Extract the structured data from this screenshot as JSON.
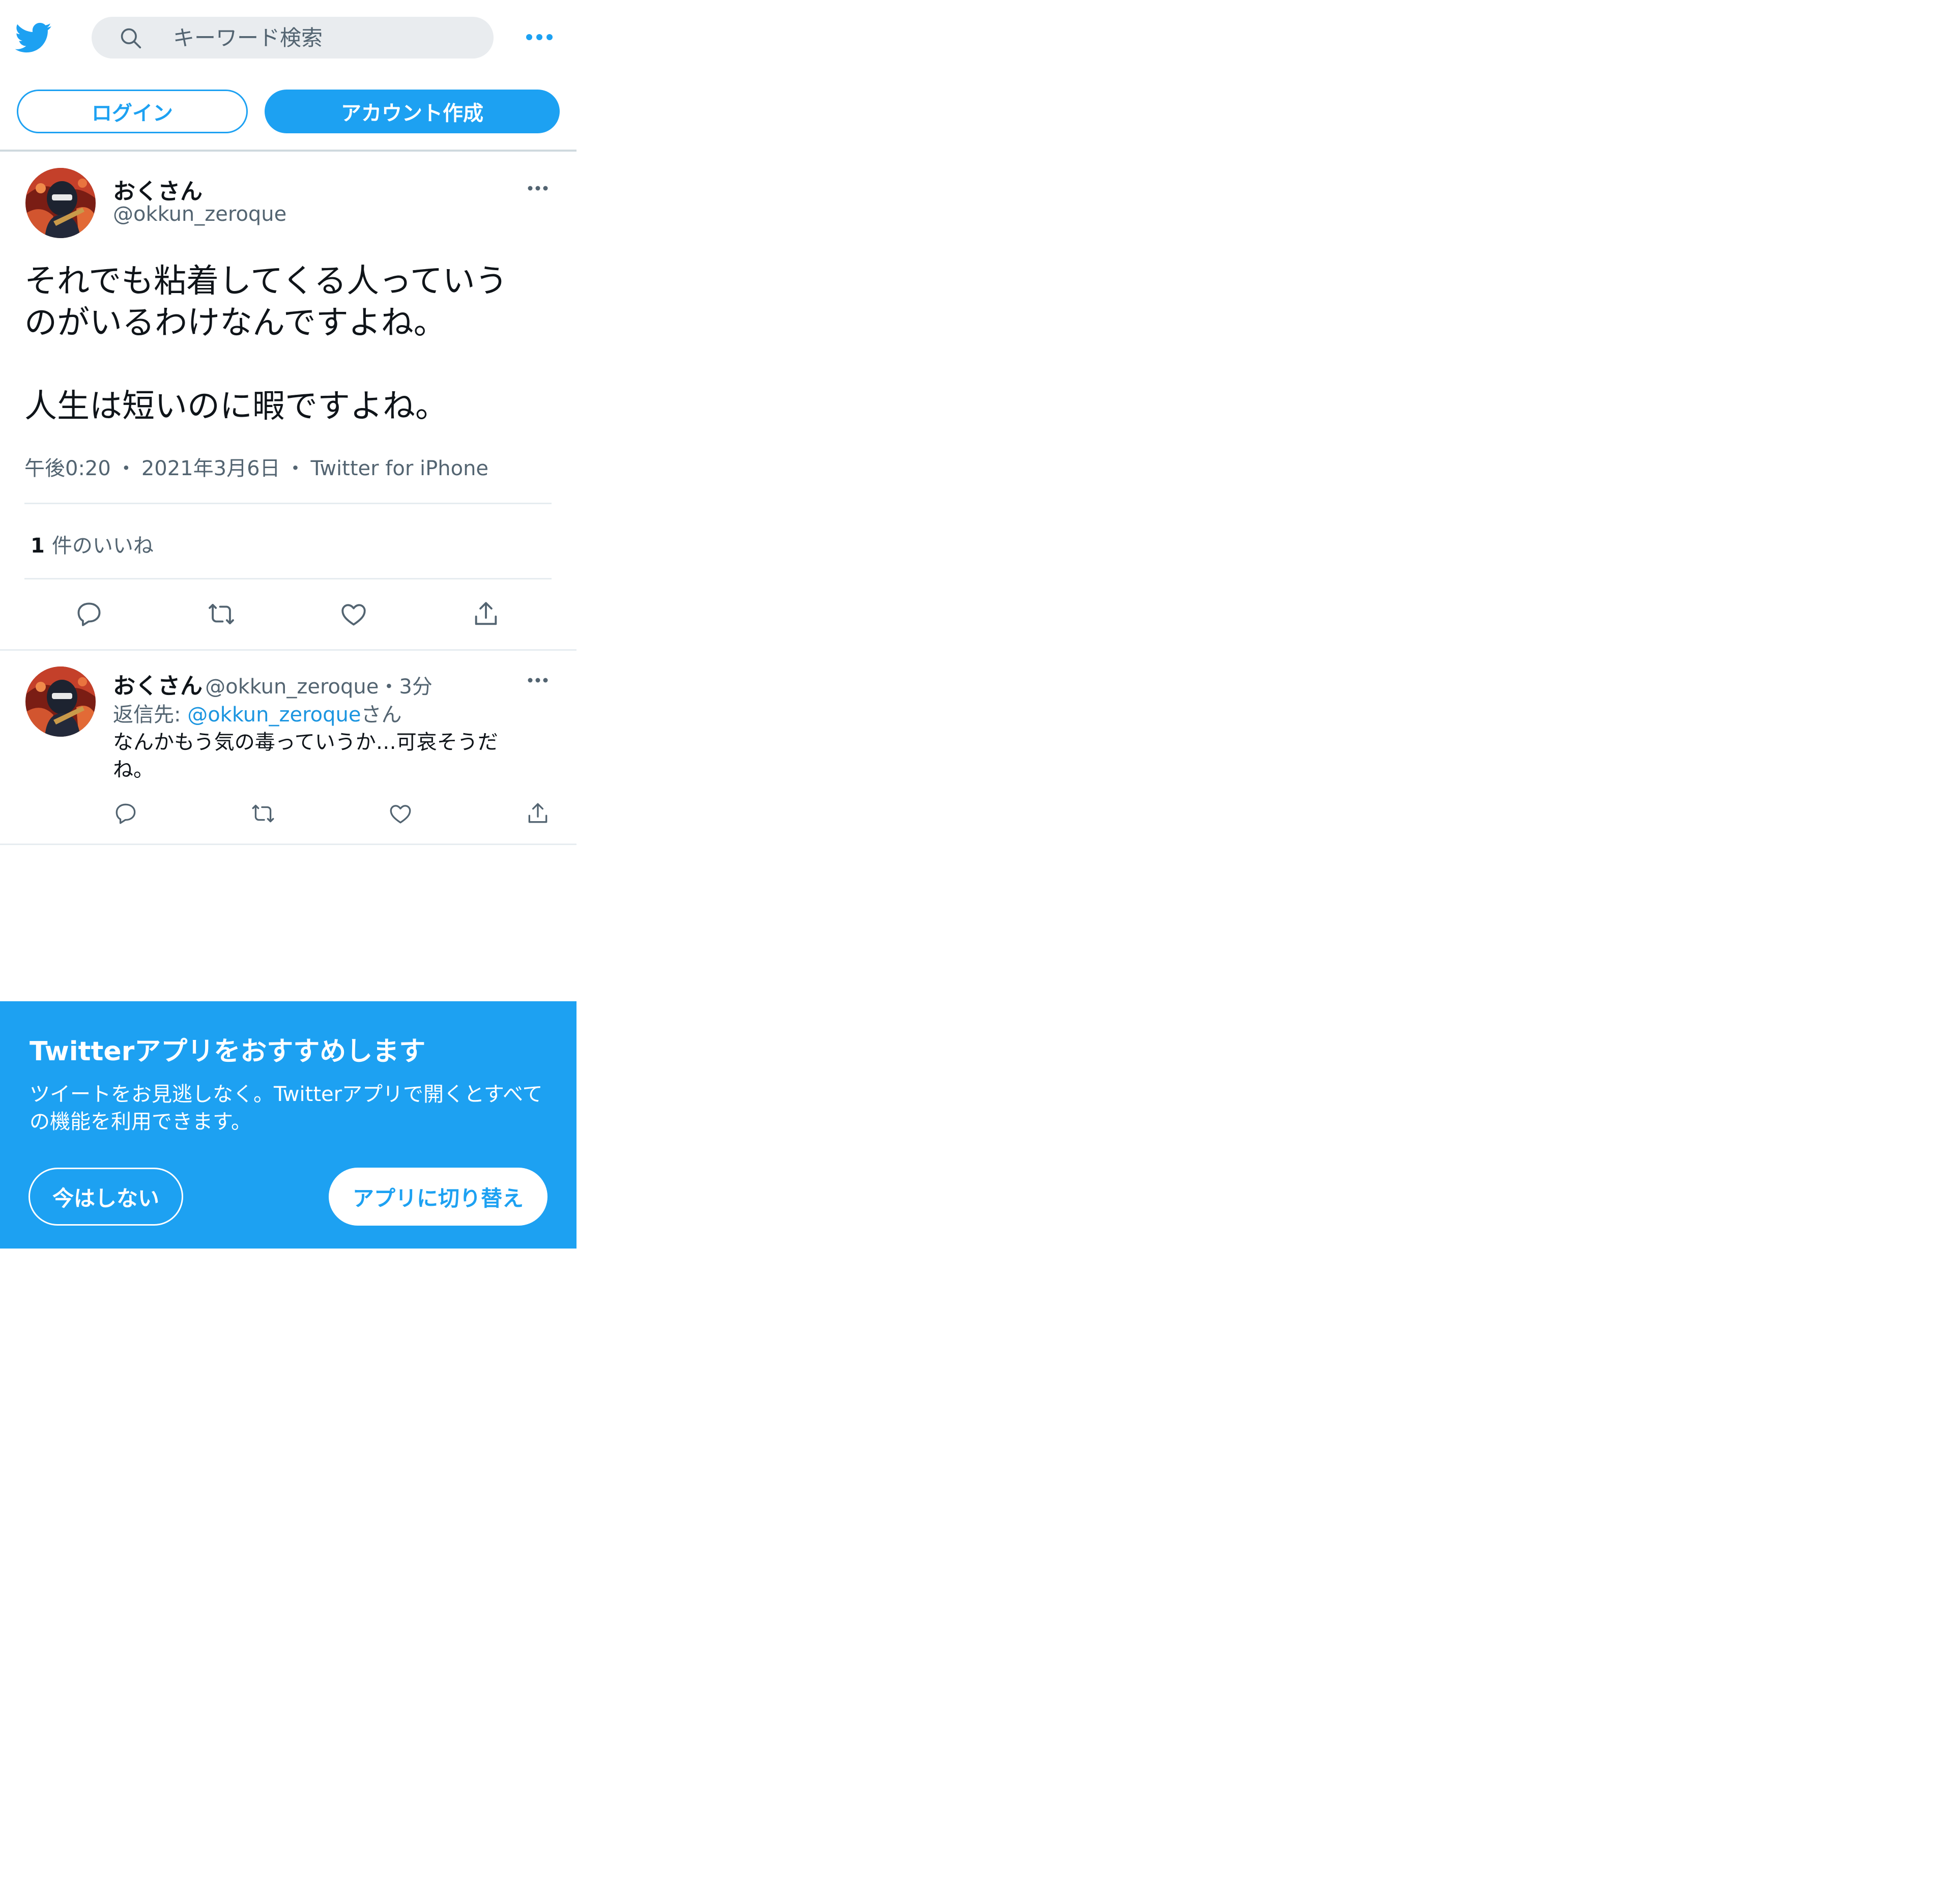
{
  "header": {
    "search_placeholder": "キーワード検索",
    "logo_icon": "twitter-bird-icon",
    "search_icon": "search-icon",
    "more_icon": "more-dots-icon",
    "brand_color": "#1da1f2"
  },
  "auth": {
    "login_label": "ログイン",
    "signup_label": "アカウント作成"
  },
  "tweet": {
    "display_name": "おくさん",
    "handle": "@okkun_zeroque",
    "text": "それでも粘着してくる人っていう\nのがいるわけなんですよね。\n\n人生は短いのに暇ですよね。",
    "time": "午後0:20",
    "separator": "・",
    "date": "2021年3月6日",
    "source": "Twitter for iPhone",
    "likes_count": "1",
    "likes_label": "件のいいね",
    "actions": [
      "reply-icon",
      "retweet-icon",
      "like-icon",
      "share-icon"
    ]
  },
  "reply": {
    "display_name": "おくさん",
    "handle": "@okkun_zeroque",
    "separator": "・",
    "time_ago": "3分",
    "reply_to_prefix": "返信先: ",
    "reply_to_mention": "@okkun_zeroque",
    "reply_to_suffix": "さん",
    "text": "なんかもう気の毒っていうか…可哀そうだね。",
    "actions": [
      "reply-icon",
      "retweet-icon",
      "like-icon",
      "share-icon"
    ]
  },
  "banner": {
    "title": "Twitterアプリをおすすめします",
    "body": "ツイートをお見逃しなく。Twitterアプリで開くとすべての機能を利用できます。",
    "not_now_label": "今はしない",
    "switch_label": "アプリに切り替え",
    "background_color": "#1da1f2"
  }
}
